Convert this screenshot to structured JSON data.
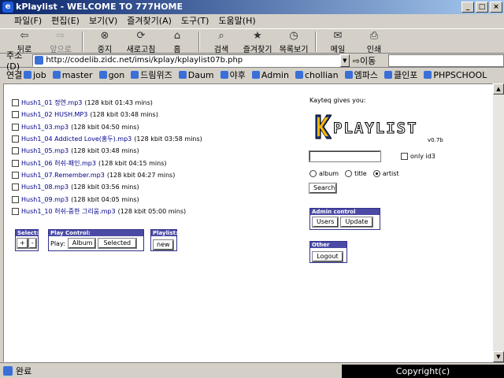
{
  "window": {
    "title": "kPlaylist - WELCOME TO 777HOME"
  },
  "menu": [
    "파일(F)",
    "편집(E)",
    "보기(V)",
    "즐겨찾기(A)",
    "도구(T)",
    "도움말(H)"
  ],
  "toolbar": [
    {
      "label": "뒤로",
      "icon": "back-arrow-icon",
      "glyph": "⇦",
      "disabled": false
    },
    {
      "label": "앞으로",
      "icon": "forward-arrow-icon",
      "glyph": "⇨",
      "disabled": true
    },
    {
      "label": "중지",
      "icon": "stop-icon",
      "glyph": "⊗",
      "disabled": false
    },
    {
      "label": "새로고침",
      "icon": "refresh-icon",
      "glyph": "⟳",
      "disabled": false
    },
    {
      "label": "홈",
      "icon": "home-icon",
      "glyph": "⌂",
      "disabled": false
    },
    {
      "label": "검색",
      "icon": "search-icon",
      "glyph": "⌕",
      "disabled": false
    },
    {
      "label": "즐겨찾기",
      "icon": "favorites-icon",
      "glyph": "★",
      "disabled": false
    },
    {
      "label": "목록보기",
      "icon": "history-icon",
      "glyph": "◷",
      "disabled": false
    },
    {
      "label": "메일",
      "icon": "mail-icon",
      "glyph": "✉",
      "disabled": false
    },
    {
      "label": "인쇄",
      "icon": "print-icon",
      "glyph": "⎙",
      "disabled": false
    }
  ],
  "address": {
    "label": "주소(D)",
    "url": "http://codelib.zidc.net/imsi/kplay/kplaylist07b.php",
    "go_label": "이동"
  },
  "links": {
    "label": "연결",
    "items": [
      "job",
      "master",
      "gon",
      "드림위즈",
      "Daum",
      "야후",
      "Admin",
      "chollian",
      "엠파스",
      "클인포",
      "PHPSCHOOL"
    ]
  },
  "tracks": [
    {
      "name": "Hush1_01 정연.mp3",
      "info": "(128 kbit 01:43 mins)"
    },
    {
      "name": "Hush1_02 HUSH.MP3",
      "info": "(128 kbit 03:48 mins)"
    },
    {
      "name": "Hush1_03.mp3",
      "info": "(128 kbit 04:50 mins)"
    },
    {
      "name": "Hush1_04 Addicted Love(홍두).mp3",
      "info": "(128 kbit 03:58 mins)"
    },
    {
      "name": "Hush1_05.mp3",
      "info": "(128 kbit 03:48 mins)"
    },
    {
      "name": "Hush1_06 허쉬-패인.mp3",
      "info": "(128 kbit 04:15 mins)"
    },
    {
      "name": "Hush1_07.Remember.mp3",
      "info": "(128 kbit 04:27 mins)"
    },
    {
      "name": "Hush1_08.mp3",
      "info": "(128 kbit 03:56 mins)"
    },
    {
      "name": "Hush1_09.mp3",
      "info": "(128 kbit 04:05 mins)"
    },
    {
      "name": "Hush1_10 허쉬-중한 그리움.mp3",
      "info": "(128 kbit 05:00 mins)"
    }
  ],
  "select_panel": {
    "title": "Select:",
    "plus": "+",
    "minus": "-"
  },
  "play_panel": {
    "title": "Play Control:",
    "play_label": "Play:",
    "album": "Album",
    "selected": "Selected"
  },
  "playlist_panel": {
    "title": "Playlist:",
    "new": "new"
  },
  "right": {
    "credit": "Kayteq gives you:",
    "logo": "PLAYLIST",
    "version": "v0.7b",
    "only_id3": "only id3",
    "radio": [
      "album",
      "title",
      "artist"
    ],
    "radio_selected": "artist",
    "search": "Search",
    "admin_title": "Admin control",
    "users": "Users",
    "update": "Update",
    "other_title": "Other",
    "logout": "Logout"
  },
  "status": {
    "text": "완료",
    "copyright": "Copyright(c) http://www.happycgi.com"
  },
  "colors": {
    "panel_title_bg": "#4b4ba6",
    "panel_border": "#32328c",
    "titlebar": "#0a246a"
  }
}
